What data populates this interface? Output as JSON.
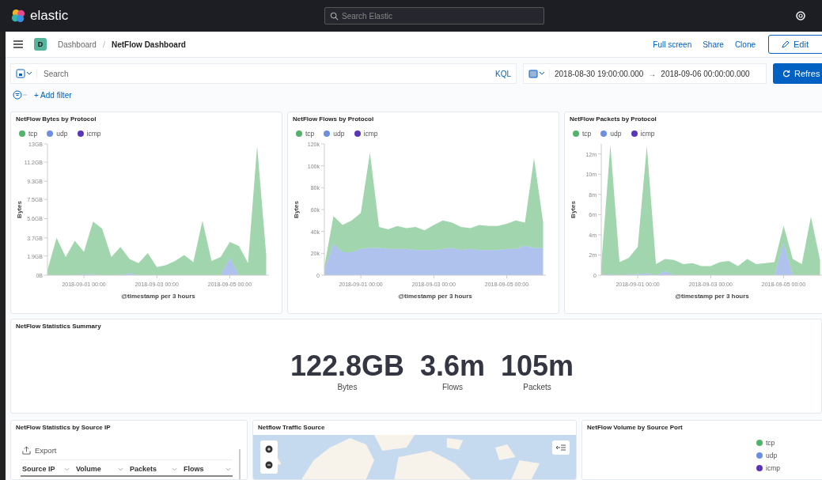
{
  "header": {
    "logo_text": "elastic",
    "search_placeholder": "Search Elastic"
  },
  "nav": {
    "app_badge": "D",
    "separator": "/",
    "breadcrumbs": [
      {
        "label": "Dashboard",
        "current": false
      },
      {
        "label": "NetFlow Dashboard",
        "current": true
      }
    ],
    "actions": [
      {
        "label": "Full screen",
        "kind": "link"
      },
      {
        "label": "Share",
        "kind": "link"
      },
      {
        "label": "Clone",
        "kind": "link"
      },
      {
        "label": "Edit",
        "kind": "button"
      }
    ]
  },
  "query": {
    "placeholder": "Search",
    "language": "KQL",
    "time_start": "2018-08-30 19:00:00.000",
    "arrow": "→",
    "time_end": "2018-09-06 00:00:00.000",
    "refresh_label": "Refres"
  },
  "filter": {
    "add_label": "+ Add filter"
  },
  "charts": [
    {
      "chart_data": {
        "type": "area",
        "stacked": true,
        "title": "NetFlow Bytes by Protocol",
        "xlabel": "@timestamp per 3 hours",
        "ylabel": "Bytes",
        "categories": [
          null,
          null,
          null,
          null,
          "2018-09-01 00:00",
          null,
          null,
          null,
          null,
          null,
          null,
          null,
          "2018-09-03 00:00",
          null,
          null,
          null,
          null,
          null,
          null,
          null,
          "2018-09-05 00:00",
          null,
          null,
          null,
          null
        ],
        "ylim": [
          0,
          13
        ],
        "yticks": [
          {
            "value": 13,
            "label": "13GB"
          },
          {
            "value": 11.2,
            "label": "11.2GB"
          },
          {
            "value": 9.3,
            "label": "9.3GB"
          },
          {
            "value": 7.5,
            "label": "7.5GB"
          },
          {
            "value": 5.6,
            "label": "5.6GB"
          },
          {
            "value": 3.7,
            "label": "3.7GB"
          },
          {
            "value": 1.9,
            "label": "1.9GB"
          },
          {
            "value": 0,
            "label": "0B"
          }
        ],
        "series": [
          {
            "name": "tcp",
            "color": "#54b36a",
            "values": [
              0.5,
              3.7,
              1.8,
              3.4,
              2.2,
              5.2,
              4.6,
              1.8,
              2.8,
              1.4,
              1.2,
              2.2,
              0.8,
              1.0,
              1.4,
              2.0,
              1.3,
              5.4,
              1.4,
              1.8,
              1.6,
              2.9,
              1.2,
              12.8,
              2.0
            ]
          },
          {
            "name": "udp",
            "color": "#6e8fe0",
            "values": [
              0,
              0,
              0,
              0,
              0.1,
              0.1,
              0,
              0,
              0,
              0.2,
              0,
              0,
              0,
              0,
              0,
              0,
              0,
              0,
              0,
              0,
              1.7,
              0,
              0,
              0,
              0
            ]
          }
        ]
      },
      "extra_legend": [
        {
          "name": "icmp",
          "color": "#5a36b8"
        }
      ]
    },
    {
      "chart_data": {
        "type": "area",
        "stacked": true,
        "title": "NetFlow Flows by Protocol",
        "xlabel": "@timestamp per 3 hours",
        "ylabel": "Bytes",
        "categories": [
          null,
          null,
          null,
          null,
          "2018-09-01 00:00",
          null,
          null,
          null,
          null,
          null,
          null,
          null,
          "2018-09-03 00:00",
          null,
          null,
          null,
          null,
          null,
          null,
          null,
          "2018-09-05 00:00",
          null,
          null,
          null,
          null
        ],
        "ylim": [
          0,
          120
        ],
        "yticks": [
          {
            "value": 120,
            "label": "120k"
          },
          {
            "value": 100,
            "label": "100k"
          },
          {
            "value": 80,
            "label": "80k"
          },
          {
            "value": 60,
            "label": "60k"
          },
          {
            "value": 40,
            "label": "40k"
          },
          {
            "value": 20,
            "label": "20k"
          },
          {
            "value": 0,
            "label": "0"
          }
        ],
        "series": [
          {
            "name": "tcp",
            "color": "#54b36a",
            "values": [
              3,
              25,
              25,
              29,
              33,
              87,
              19,
              18,
              21,
              19,
              21,
              18,
              23,
              26,
              23,
              21,
              19,
              23,
              22,
              22,
              23,
              26,
              21,
              82,
              23
            ]
          },
          {
            "name": "udp",
            "color": "#6e8fe0",
            "values": [
              5,
              29,
              21,
              21,
              24,
              25,
              25,
              24,
              24,
              24,
              23,
              23,
              23,
              24,
              25,
              23,
              24,
              23,
              23,
              23,
              24,
              24,
              27,
              25,
              25
            ]
          }
        ]
      },
      "extra_legend": [
        {
          "name": "icmp",
          "color": "#5a36b8"
        }
      ]
    },
    {
      "chart_data": {
        "type": "area",
        "stacked": true,
        "title": "NetFlow Packets by Protocol",
        "xlabel": "@timestamp per 3 hours",
        "ylabel": "Bytes",
        "categories": [
          null,
          null,
          null,
          null,
          "2018-09-01 00:00",
          null,
          null,
          null,
          null,
          null,
          null,
          null,
          "2018-09-03 00:00",
          null,
          null,
          null,
          null,
          null,
          null,
          null,
          "2018-09-05 00:00",
          null,
          null,
          null,
          null
        ],
        "ylim": [
          0,
          13
        ],
        "yticks": [
          {
            "value": 12,
            "label": "12m"
          },
          {
            "value": 10,
            "label": "10m"
          },
          {
            "value": 8,
            "label": "8m"
          },
          {
            "value": 6,
            "label": "6m"
          },
          {
            "value": 4,
            "label": "4m"
          },
          {
            "value": 2,
            "label": "2m"
          },
          {
            "value": 0,
            "label": "0"
          }
        ],
        "series": [
          {
            "name": "tcp",
            "color": "#54b36a",
            "values": [
              1,
              12.8,
              1.3,
              1.6,
              2.7,
              12.6,
              1.1,
              1.2,
              1.5,
              1.1,
              1.2,
              0.9,
              0.9,
              1.3,
              1.4,
              0.9,
              1.6,
              1.1,
              1.2,
              1.3,
              1.7,
              1.6,
              1.1,
              5.8,
              1.5
            ]
          },
          {
            "name": "udp",
            "color": "#6e8fe0",
            "values": [
              0,
              0.1,
              0,
              0.1,
              0.1,
              0.2,
              0,
              0.4,
              0,
              0,
              0,
              0,
              0,
              0,
              0,
              0,
              0,
              0,
              0,
              0,
              3.2,
              0,
              0,
              0,
              0
            ]
          }
        ]
      },
      "extra_legend": [
        {
          "name": "icmp",
          "color": "#5a36b8"
        }
      ]
    }
  ],
  "summary": {
    "title": "NetFlow Statistics Summary",
    "metrics": [
      {
        "value": "122.8GB",
        "label": "Bytes"
      },
      {
        "value": "3.6m",
        "label": "Flows"
      },
      {
        "value": "105m",
        "label": "Packets"
      }
    ]
  },
  "source_ip": {
    "title": "NetFlow Statistics by Source IP",
    "export_label": "Export",
    "columns": [
      "Source IP",
      "Volume",
      "Packets",
      "Flows"
    ]
  },
  "map": {
    "title": "Netflow Traffic Source"
  },
  "volume": {
    "title": "NetFlow Volume by Source Port",
    "legend": [
      {
        "name": "tcp",
        "color": "#54b36a"
      },
      {
        "name": "udp",
        "color": "#6e8fe0"
      },
      {
        "name": "icmp",
        "color": "#5a36b8"
      }
    ]
  }
}
